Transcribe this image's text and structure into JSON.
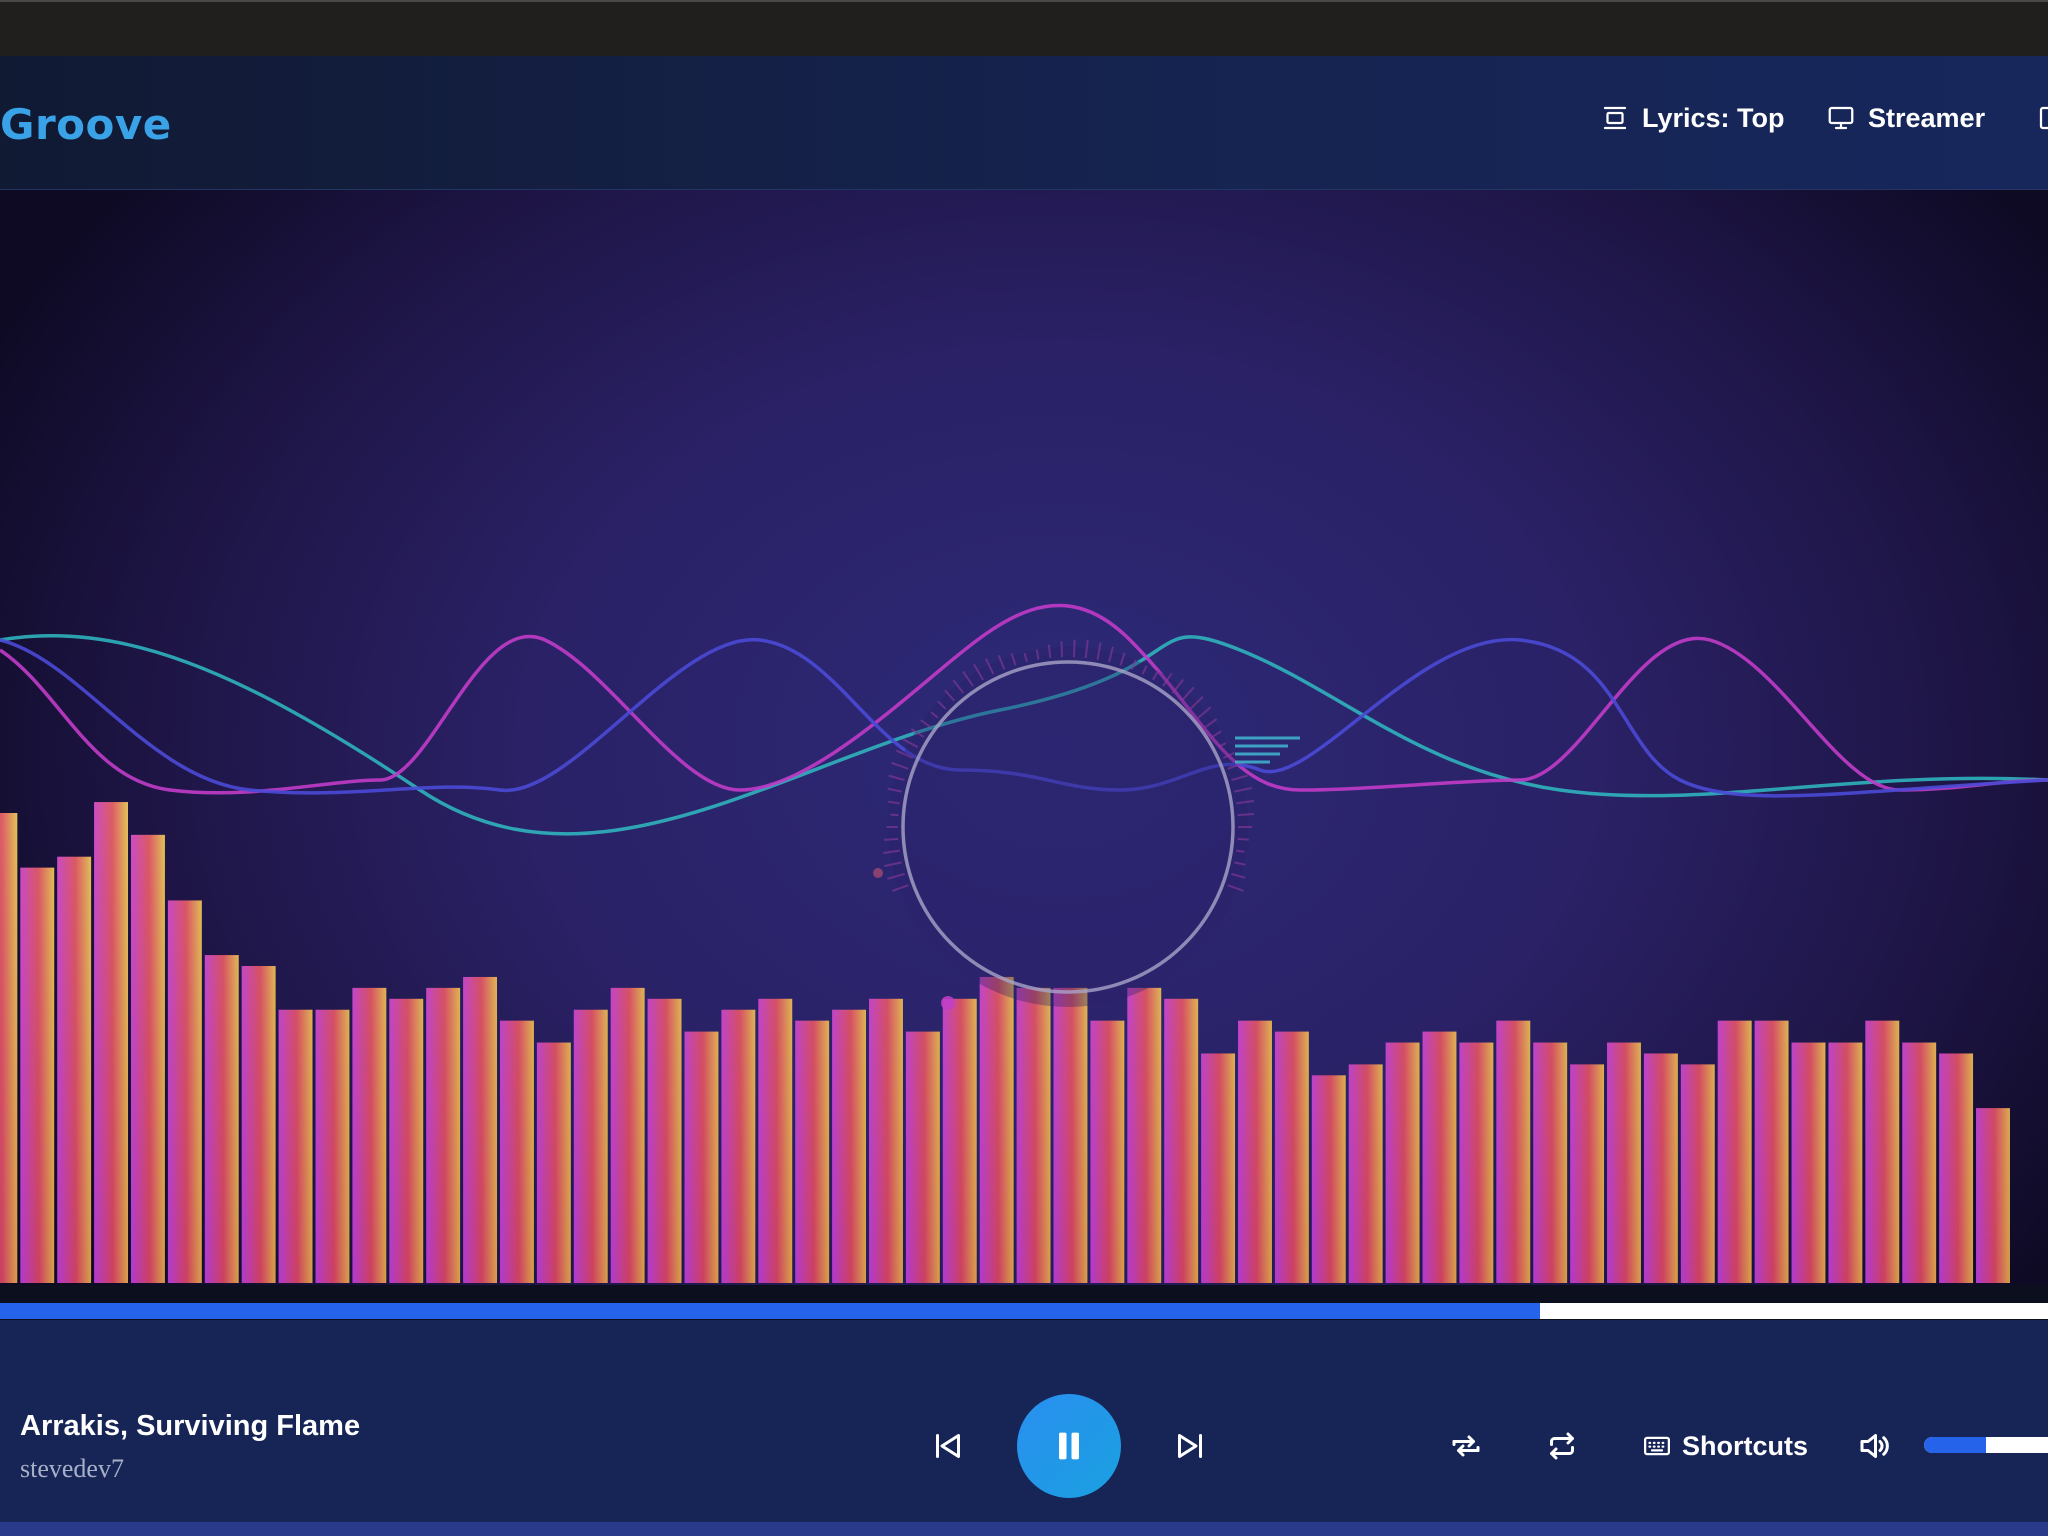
{
  "app": {
    "brand": "Groove"
  },
  "header": {
    "lyrics_label": "Lyrics: Top",
    "streamer_label": "Streamer"
  },
  "player": {
    "track_title": "Arrakis, Surviving Flame",
    "artist": "stevedev7",
    "shortcuts_label": "Shortcuts",
    "state": "playing",
    "progress": 0.752,
    "volume": 0.5
  },
  "visualizer": {
    "colors": {
      "bar_top_start": "#f266b3",
      "bar_top_end": "#f0ee6e",
      "bar_bottom_start": "#b13ad0",
      "bar_bottom_end": "#d8a04a",
      "wave_teal": "#2fb3bd",
      "wave_magenta": "#c13cc8",
      "wave_blue": "#4a4ad6"
    },
    "spectrum_levels": [
      0.43,
      0.38,
      0.39,
      0.44,
      0.41,
      0.35,
      0.3,
      0.29,
      0.25,
      0.25,
      0.27,
      0.26,
      0.27,
      0.28,
      0.24,
      0.22,
      0.25,
      0.27,
      0.26,
      0.23,
      0.25,
      0.26,
      0.24,
      0.25,
      0.26,
      0.23,
      0.26,
      0.28,
      0.27,
      0.27,
      0.24,
      0.27,
      0.26,
      0.21,
      0.24,
      0.23,
      0.19,
      0.2,
      0.22,
      0.23,
      0.22,
      0.24,
      0.22,
      0.2,
      0.22,
      0.21,
      0.2,
      0.24,
      0.24,
      0.22,
      0.22,
      0.24,
      0.22,
      0.21,
      0.16
    ]
  },
  "icons": {
    "lyrics": "lyrics-position-icon",
    "streamer": "monitor-icon",
    "window": "window-icon",
    "prev": "skip-previous-icon",
    "play_pause": "pause-icon",
    "next": "skip-next-icon",
    "shuffle": "shuffle-icon",
    "repeat": "repeat-icon",
    "keyboard": "keyboard-icon",
    "volume": "volume-icon"
  }
}
